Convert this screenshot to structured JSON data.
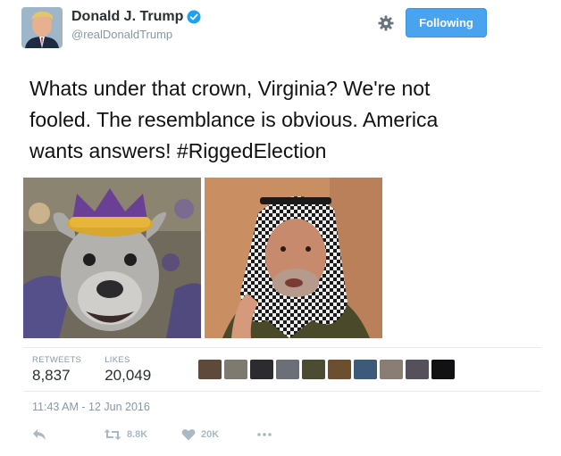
{
  "author": {
    "name": "Donald J. Trump",
    "handle": "@realDonaldTrump",
    "avatar_icon": "profile-photo"
  },
  "follow_button": {
    "label": "Following"
  },
  "tweet": {
    "lines": [
      "Whats under that crown, Virginia? We're not",
      "fooled.  The resemblance is obvious. America",
      "wants answers!  #RiggedElection"
    ]
  },
  "media": [
    {
      "name": "mascot-photo"
    },
    {
      "name": "portrait-photo"
    }
  ],
  "stats": {
    "retweets_label": "RETWEETS",
    "retweets_value": "8,837",
    "likes_label": "LIKES",
    "likes_value": "20,049"
  },
  "timestamp": "11:43 AM - 12 Jun 2016",
  "actions": {
    "retweet_count": "8.8K",
    "like_count": "20K"
  },
  "colors": {
    "follow_blue": "#4aa3ef",
    "verified_blue": "#1da1f2",
    "muted": "#8899a6"
  }
}
